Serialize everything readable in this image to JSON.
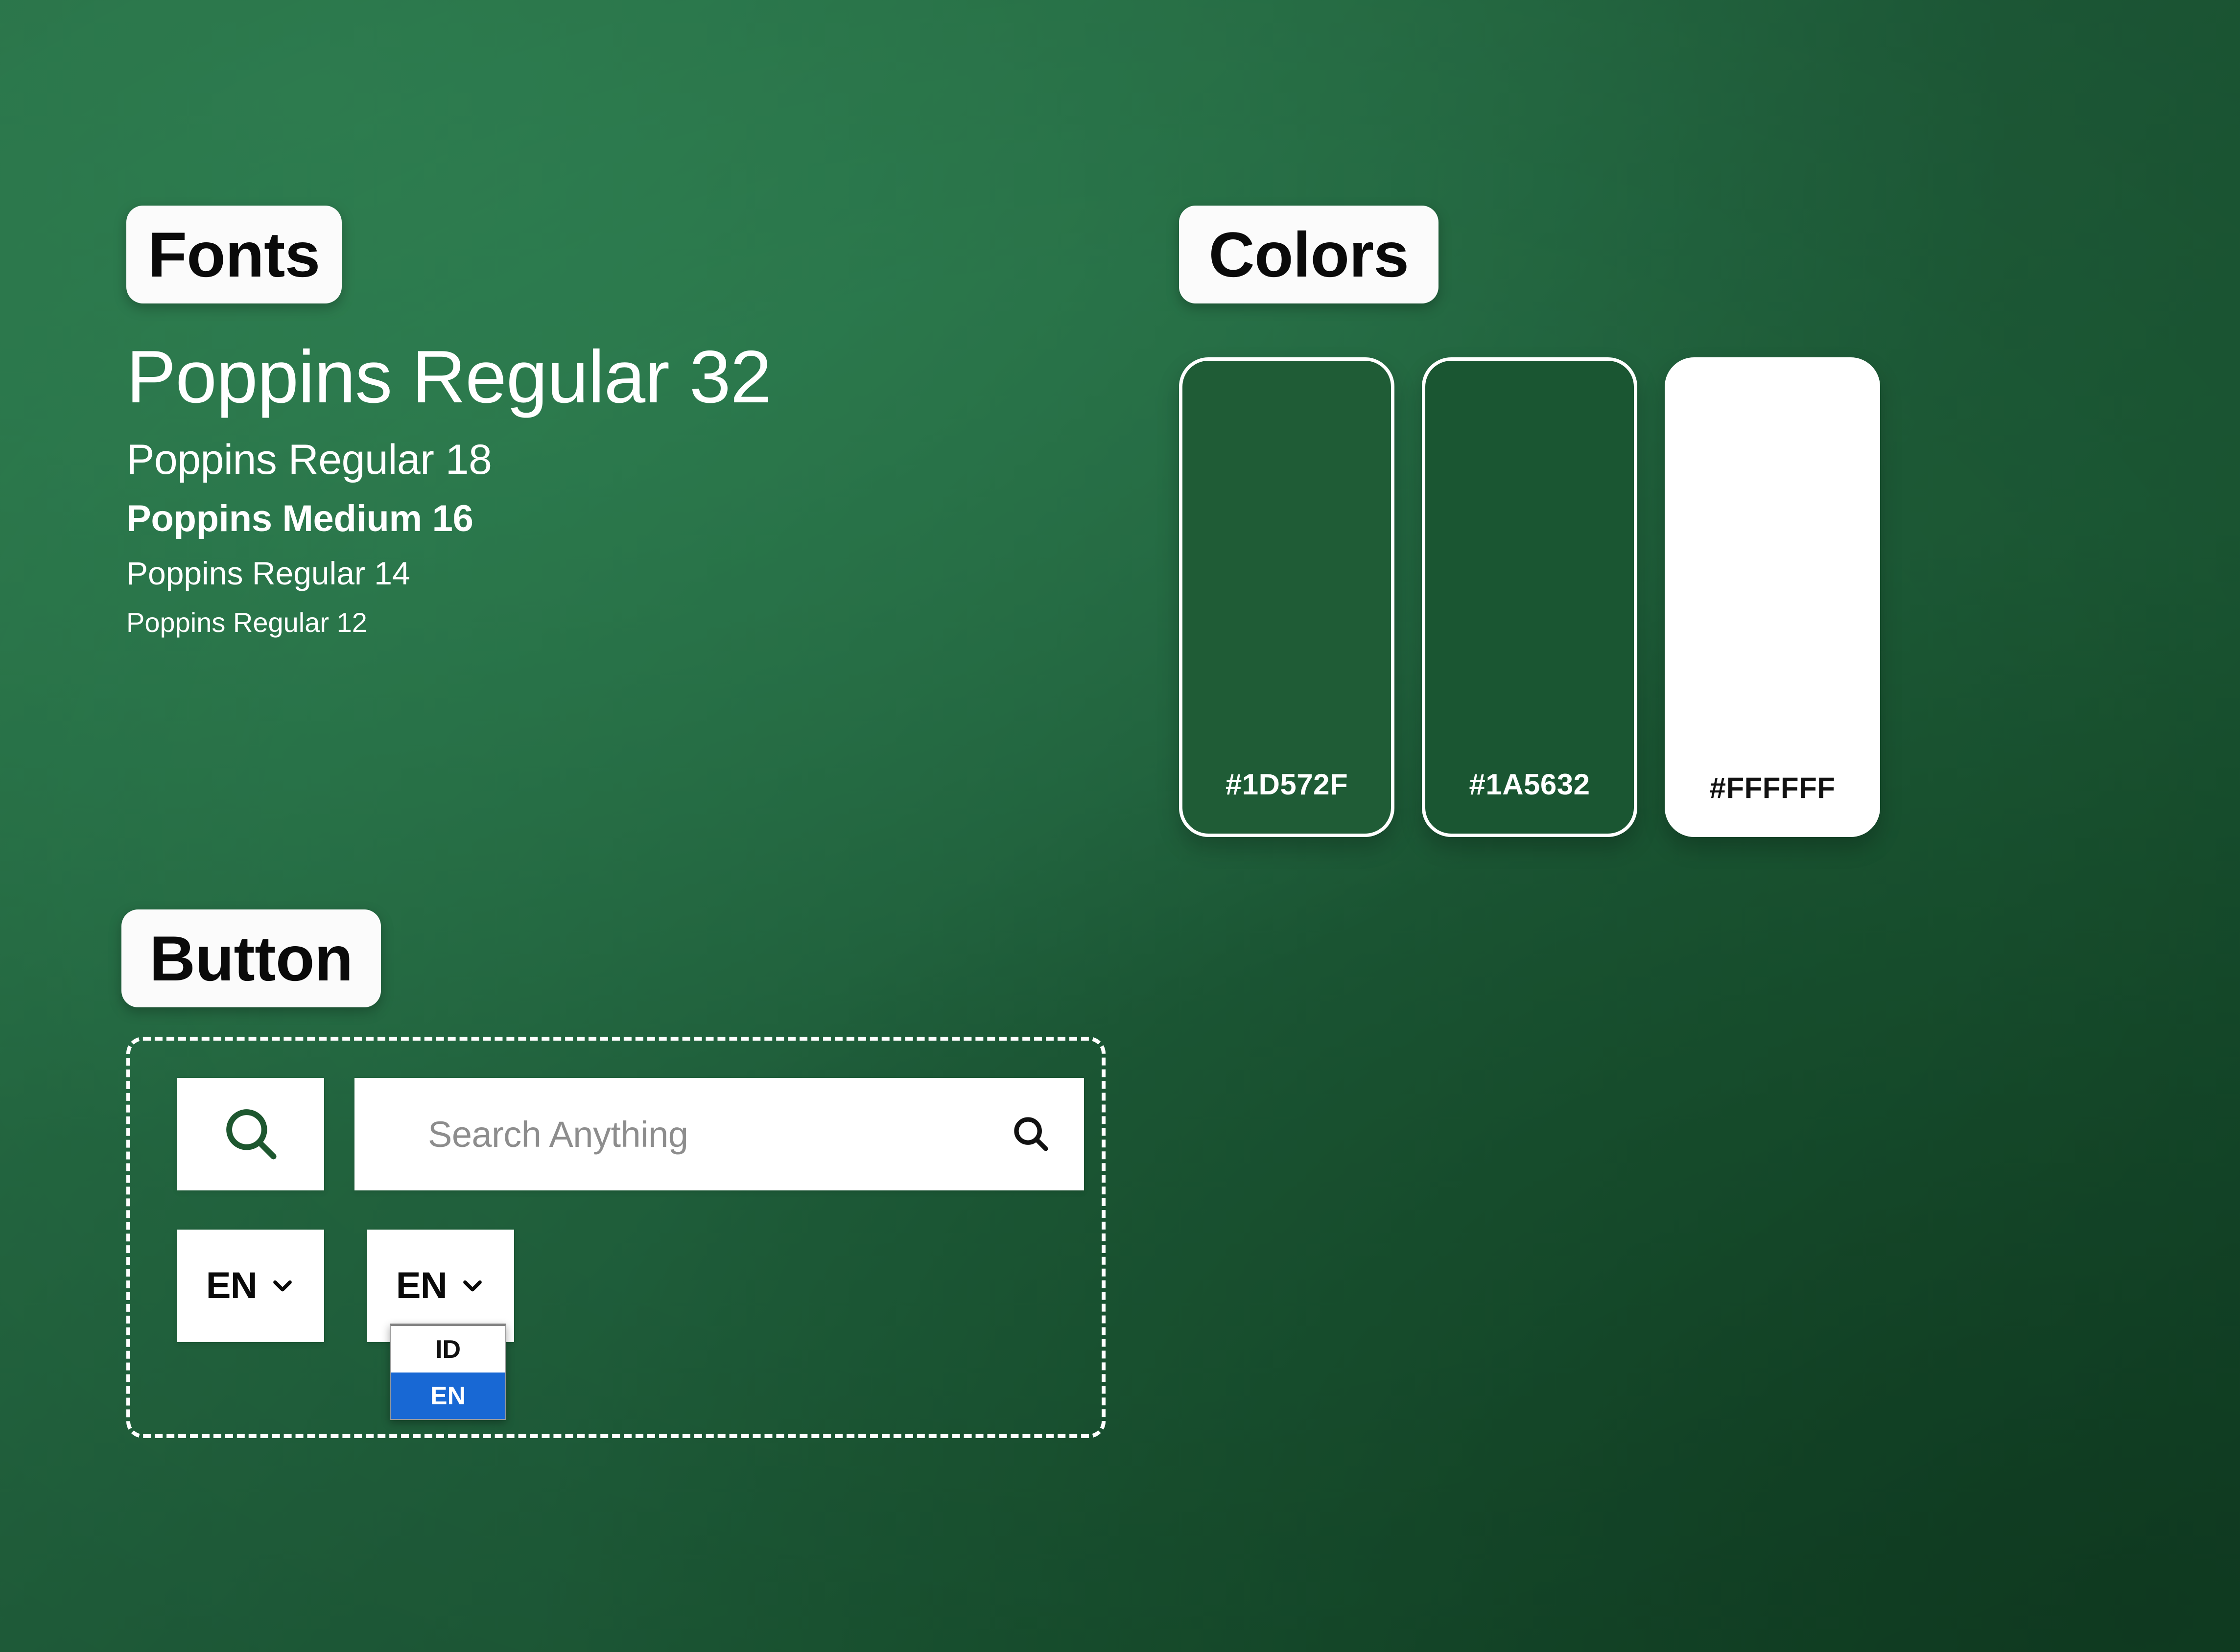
{
  "background": {
    "gradient_from": "#2C7A4C",
    "gradient_to": "#144B2B"
  },
  "sections": {
    "fonts": {
      "label": "Fonts"
    },
    "colors": {
      "label": "Colors"
    },
    "button": {
      "label": "Button"
    }
  },
  "fonts": {
    "specimens": [
      {
        "text": "Poppins Regular 32",
        "size": 32,
        "weight": "Regular"
      },
      {
        "text": "Poppins Regular 18",
        "size": 18,
        "weight": "Regular"
      },
      {
        "text": "Poppins Medium 16",
        "size": 16,
        "weight": "Medium"
      },
      {
        "text": "Poppins Regular 14",
        "size": 14,
        "weight": "Regular"
      },
      {
        "text": "Poppins Regular 12",
        "size": 12,
        "weight": "Regular"
      }
    ]
  },
  "colors": {
    "swatches": [
      {
        "hex": "#1D572F",
        "label": "#1D572F",
        "style": "outlined"
      },
      {
        "hex": "#1A5632",
        "label": "#1A5632",
        "style": "outlined"
      },
      {
        "hex": "#FFFFFF",
        "label": "#FFFFFF",
        "style": "solid"
      }
    ]
  },
  "button_section": {
    "search_icon_button": {
      "icon": "search-icon",
      "icon_color": "#1D572F"
    },
    "search_field": {
      "placeholder": "Search Anything",
      "value": "",
      "submit_icon": "search-icon",
      "submit_icon_color": "#111111"
    },
    "language_select_closed": {
      "value": "EN",
      "chevron_icon": "chevron-down-icon"
    },
    "language_select_open": {
      "value": "EN",
      "chevron_icon": "chevron-down-icon",
      "options": [
        {
          "label": "ID",
          "selected": false
        },
        {
          "label": "EN",
          "selected": true
        }
      ],
      "highlight_color": "#1868D4"
    }
  }
}
